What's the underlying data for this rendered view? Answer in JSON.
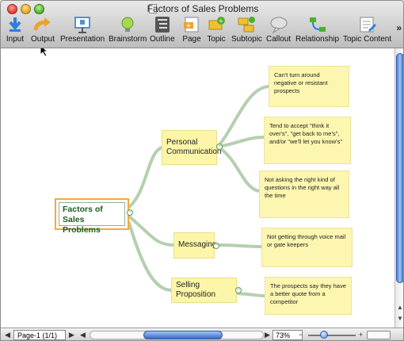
{
  "window": {
    "title": "Factors of Sales Problems"
  },
  "toolbar": {
    "items": [
      {
        "label": "Input",
        "icon": "input-arrow-icon"
      },
      {
        "label": "Output",
        "icon": "output-arrow-icon"
      },
      {
        "label": "Presentation",
        "icon": "presentation-icon"
      },
      {
        "label": "Brainstorm",
        "icon": "brainstorm-bulb-icon"
      },
      {
        "label": "Outline",
        "icon": "outline-icon"
      },
      {
        "label": "Page",
        "icon": "page-icon"
      },
      {
        "label": "Topic",
        "icon": "topic-icon"
      },
      {
        "label": "Subtopic",
        "icon": "subtopic-icon"
      },
      {
        "label": "Callout",
        "icon": "callout-icon"
      },
      {
        "label": "Relationship",
        "icon": "relationship-icon"
      },
      {
        "label": "Topic Content",
        "icon": "topic-content-icon"
      }
    ],
    "overflow": "»"
  },
  "map": {
    "root": "Factors of Sales Problems",
    "topics": [
      {
        "label": "Personal Communication",
        "notes": [
          "Can't turn around negative or resistant prospects",
          "Tend to accept \"think it over's\", \"get back to me's\", and/or \"we'll let you know's\"",
          "Not asking the right kind of questions in the right way all the time"
        ]
      },
      {
        "label": "Messaging",
        "notes": [
          "Not getting through voice mail or gate keepers"
        ]
      },
      {
        "label": "Selling Proposition",
        "notes": [
          "The prospects say they have a better quote from a competitor"
        ]
      }
    ]
  },
  "statusbar": {
    "page": "Page-1 (1/1)",
    "zoom": "73%"
  },
  "colors": {
    "branch": "#b5cfb0",
    "topic_fill": "#fdf6a8",
    "root_border": "#f2a93b",
    "root_text": "#1d5e1d"
  }
}
